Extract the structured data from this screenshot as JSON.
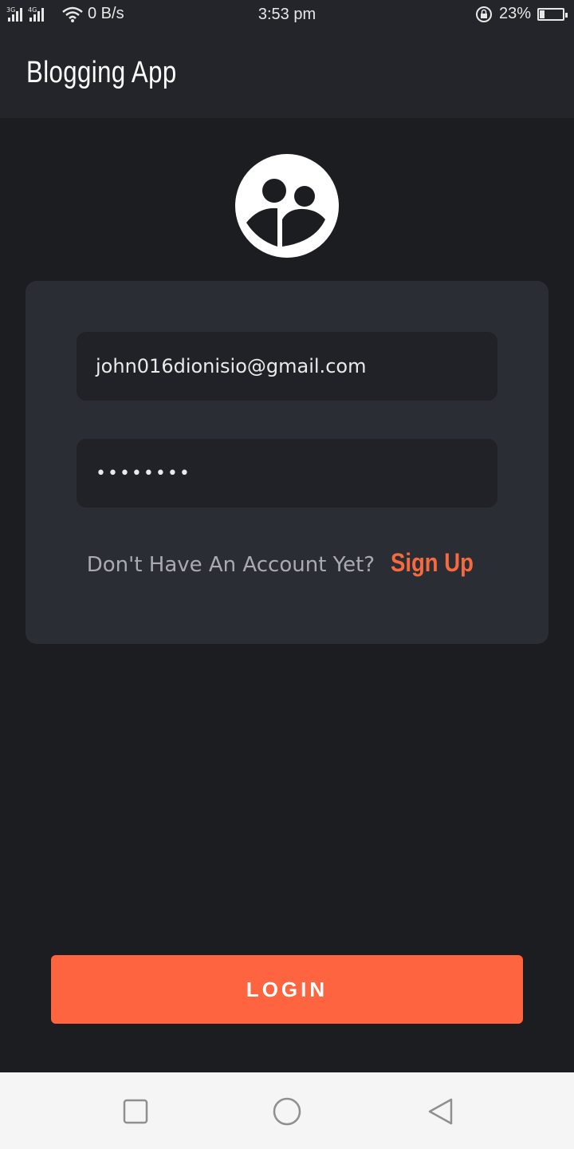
{
  "status_bar": {
    "network": "3G 4G",
    "speed": "0 B/s",
    "time": "3:53 pm",
    "battery": "23%",
    "battery_level": 0.23
  },
  "app_bar": {
    "title": "Blogging App"
  },
  "logo": {
    "icon": "blog-logo-icon"
  },
  "login_form": {
    "email_value": "john016dionisio@gmail.com",
    "password_value": "••••••••",
    "signup_prompt": "Don't Have An Account Yet?",
    "signup_link": "Sign Up"
  },
  "login_button": {
    "label": "LOGIN"
  },
  "nav_bar": {
    "recents_icon": "square-icon",
    "home_icon": "circle-icon",
    "back_icon": "triangle-back-icon"
  },
  "colors": {
    "background": "#1b1d21",
    "app_bar": "#23252b",
    "card": "#2b2d35",
    "field": "#202227",
    "accent": "#fd643f",
    "signup_link": "#f56a3e"
  }
}
